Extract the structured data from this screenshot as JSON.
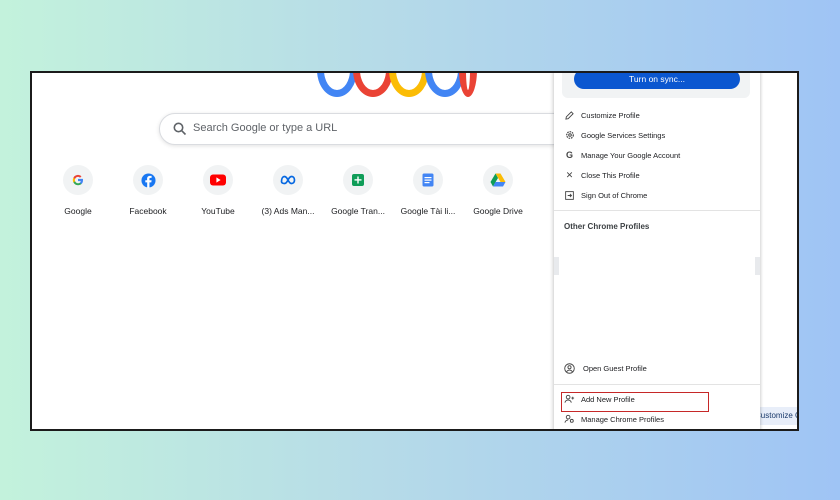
{
  "search": {
    "placeholder": "Search Google or type a URL"
  },
  "shortcuts": [
    {
      "label": "Google",
      "icon": "google-g-icon"
    },
    {
      "label": "Facebook",
      "icon": "facebook-icon"
    },
    {
      "label": "YouTube",
      "icon": "youtube-icon"
    },
    {
      "label": "(3) Ads Man...",
      "icon": "meta-icon"
    },
    {
      "label": "Google Tran...",
      "icon": "google-sheets-icon"
    },
    {
      "label": "Google Tài li...",
      "icon": "google-docs-icon"
    },
    {
      "label": "Google Drive",
      "icon": "google-drive-icon"
    }
  ],
  "customize_chrome": {
    "label": "Customize C"
  },
  "profile_menu": {
    "sync_button": "Turn on sync...",
    "items": [
      {
        "label": "Customize Profile",
        "icon": "pencil-icon"
      },
      {
        "label": "Google Services Settings",
        "icon": "settings-icon"
      },
      {
        "label": "Manage Your Google Account",
        "icon": "google-g-icon"
      },
      {
        "label": "Close This Profile",
        "icon": "close-icon"
      },
      {
        "label": "Sign Out of Chrome",
        "icon": "sign-out-icon"
      }
    ],
    "other_profiles_heading": "Other Chrome Profiles",
    "guest": {
      "label": "Open Guest Profile",
      "icon": "guest-profile-icon"
    },
    "add_profile": {
      "label": "Add New Profile",
      "icon": "add-person-icon"
    },
    "manage_profiles": {
      "label": "Manage Chrome Profiles",
      "icon": "manage-profiles-icon"
    }
  },
  "colors": {
    "accent_blue": "#0b57d0",
    "highlight_red": "#c62828",
    "google_blue": "#4285f4",
    "google_red": "#ea4335",
    "google_yellow": "#fbbc05",
    "google_green": "#34a853"
  }
}
